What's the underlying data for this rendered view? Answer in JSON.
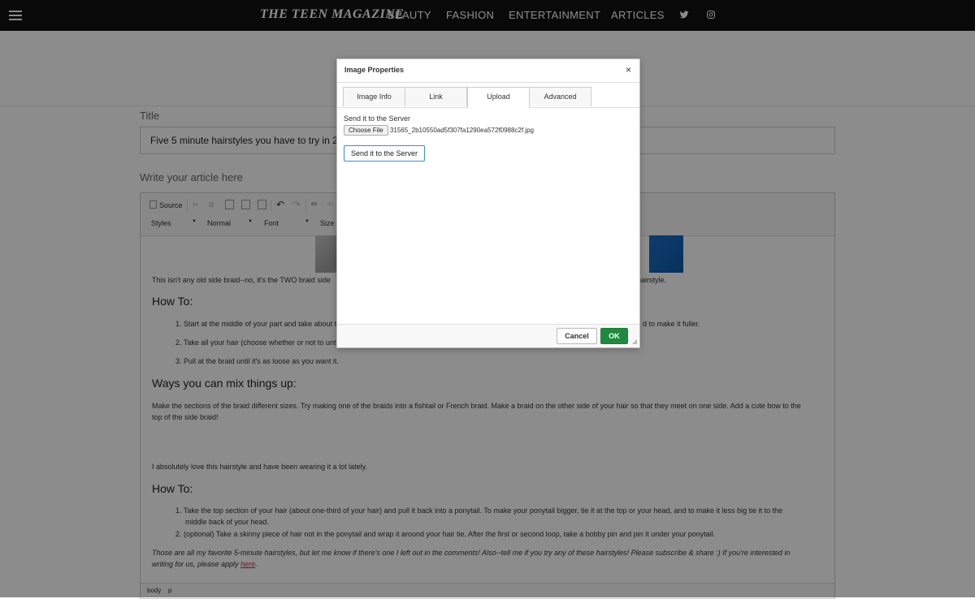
{
  "header": {
    "logo": "THE TEEN MAGAZINE",
    "nav": [
      "BEAUTY",
      "FASHION",
      "ENTERTAINMENT",
      "ARTICLES"
    ],
    "icons": [
      "twitter-icon",
      "instagram-icon"
    ]
  },
  "form": {
    "title_label": "Title",
    "title_value": "Five 5 minute hairstyles you have to try in 201",
    "article_label": "Write your article here"
  },
  "toolbar": {
    "source": "Source",
    "styles": "Styles",
    "format": "Normal",
    "font": "Font",
    "size": "Size"
  },
  "article": {
    "p1_left": "This isn't any old side braid--no, it's the TWO braid side",
    "p1_right": "s hairstyle.",
    "h1": "How To:",
    "s1_1_left": "Start at the middle of your part and take about th",
    "s1_1_right": "d to make it fuller.",
    "s1_2": "Take all your hair (choose whether or not to untie",
    "s1_3": "Pull at the braid until it's as loose as you want it.",
    "h2": "Ways you can mix things up:",
    "p2_a": "Make the sections of the braid different sizes. Try making one of the braids into a fishtail or French braid. Make a braid on the other side of your hair so that they meet on one side. Add a cute bow to the",
    "p2_b": "top of the side braid!",
    "p3": "I absolutely love this hairstyle and have been wearing it a lot lately.",
    "h3": "How To:",
    "s2_1_a": "Take the top section of your hair (about one-third of your hair) and pull it back into a ponytail. To make your ponytail bigger, tie it at the top or your head, and to make it less big tie it to the",
    "s2_1_b": "middle back of your head.",
    "s2_2": "(optional) Take a skinny piece of hair not in the ponytail and wrap it around your hair tie. After the first or second loop, take a bobby pin and pin it under your ponytail.",
    "closing_a": "Those are all my favorite 5-minute hairstyles, but let me know if there's one I left out in the comments! Also--tell me if you try any of these hairstyles! Please subscribe & share :) If you're interested in",
    "closing_b": "writing for us, please apply",
    "closing_link": "here",
    "closing_end": "."
  },
  "statusbar": {
    "path": [
      "body",
      "p"
    ]
  },
  "dialog": {
    "title": "Image Properties",
    "close": "×",
    "tabs": [
      "Image Info",
      "Link",
      "Upload",
      "Advanced"
    ],
    "active_tab": "Upload",
    "upload_label": "Send it to the Server",
    "choose_file": "Choose File",
    "filename": "31565_2b10550ad5f307fa1290ea572f0988c2f.jpg",
    "send_button": "Send it to the Server",
    "cancel": "Cancel",
    "ok": "OK"
  },
  "colors": {
    "topbar": "#111111",
    "ok_button": "#1f8a3f",
    "link": "#c0304a",
    "overlay": "rgba(0,0,0,0.45)"
  }
}
